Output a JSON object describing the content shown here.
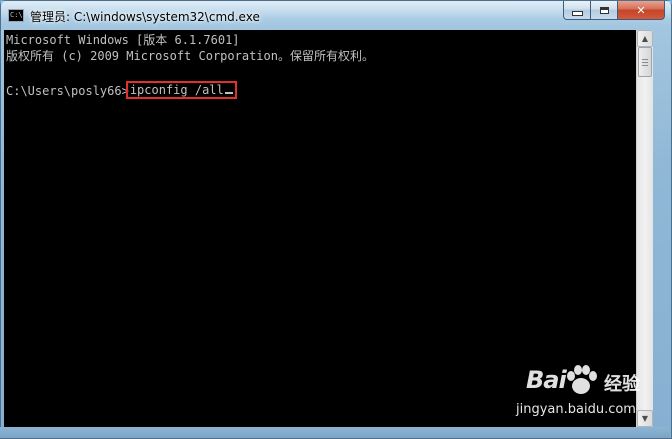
{
  "window": {
    "title": "管理员: C:\\windows\\system32\\cmd.exe",
    "icon": "console-icon",
    "icon_text": "C:\\",
    "buttons": {
      "minimize": "minimize-icon",
      "maximize": "maximize-icon",
      "close": "✕"
    }
  },
  "console": {
    "lines": [
      "Microsoft Windows [版本 6.1.7601]",
      "版权所有 (c) 2009 Microsoft Corporation。保留所有权利。"
    ],
    "prompt": "C:\\Users\\posly66>",
    "command": "ipconfig /all"
  },
  "colors": {
    "console_bg": "#000000",
    "console_fg": "#c0c0c0",
    "highlight_border": "#e0312c",
    "close_button": "#c3452a"
  },
  "watermark": {
    "logo": "Bai",
    "logo_suffix": "经验",
    "url": "jingyan.baidu.com"
  }
}
